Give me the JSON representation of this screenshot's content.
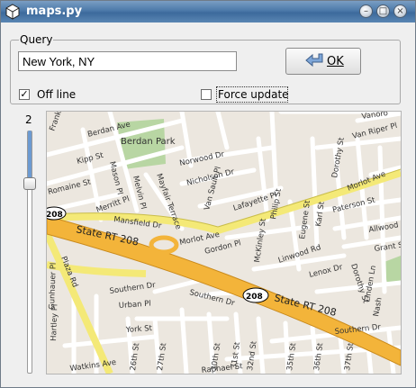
{
  "window": {
    "title": "maps.py",
    "buttons": [
      "minimize",
      "maximize",
      "close"
    ]
  },
  "query": {
    "group_label": "Query",
    "value": "New York, NY"
  },
  "ok_button": {
    "label": "OK"
  },
  "options": {
    "offline": {
      "label": "Off line",
      "checked": true
    },
    "force_update": {
      "label": "Force update",
      "checked": false
    }
  },
  "zoom": {
    "value": "2"
  },
  "map": {
    "park_label": "Berdan Park",
    "highway_label_1": "State RT 208",
    "highway_label_2": "State RT 208",
    "shield_label": "208",
    "colors": {
      "highway": "#f3b43a",
      "major_road": "#f4e977",
      "park": "#b8d6a3",
      "background": "#ece7df"
    },
    "streets": [
      "Berdan Ave",
      "Franklin St",
      "Kipp St",
      "Mason Pl",
      "Romaine St",
      "Merritt Pl",
      "Melvin Pl",
      "Mayfair Terrace",
      "Norwood Dr",
      "Nicholson Dr",
      "Van Saun Pl",
      "Lafayette Pl",
      "Morlot Ave",
      "Morlot Ave",
      "Paterson St",
      "Van Riper Pl",
      "Vanoro",
      "Dorothy St",
      "Philip St",
      "Eugene St",
      "Karl St",
      "Mansfield Dr",
      "Gordon Pl",
      "McKinley St",
      "Linwood Rd",
      "Lenox Dr",
      "Dorothy St",
      "Linden Ln",
      "Southern Dr",
      "Urban Pl",
      "Southern Dr",
      "York St",
      "Plaza Rd",
      "Gunhauer Pl",
      "Hartley Pl",
      "Watkins Ave",
      "26th St",
      "27th St",
      "30th St",
      "31st St",
      "32nd St",
      "Raphael St",
      "35th St",
      "36th St",
      "37th St",
      "Grant St",
      "Allwood",
      "Southern Dr",
      "Nash"
    ]
  }
}
